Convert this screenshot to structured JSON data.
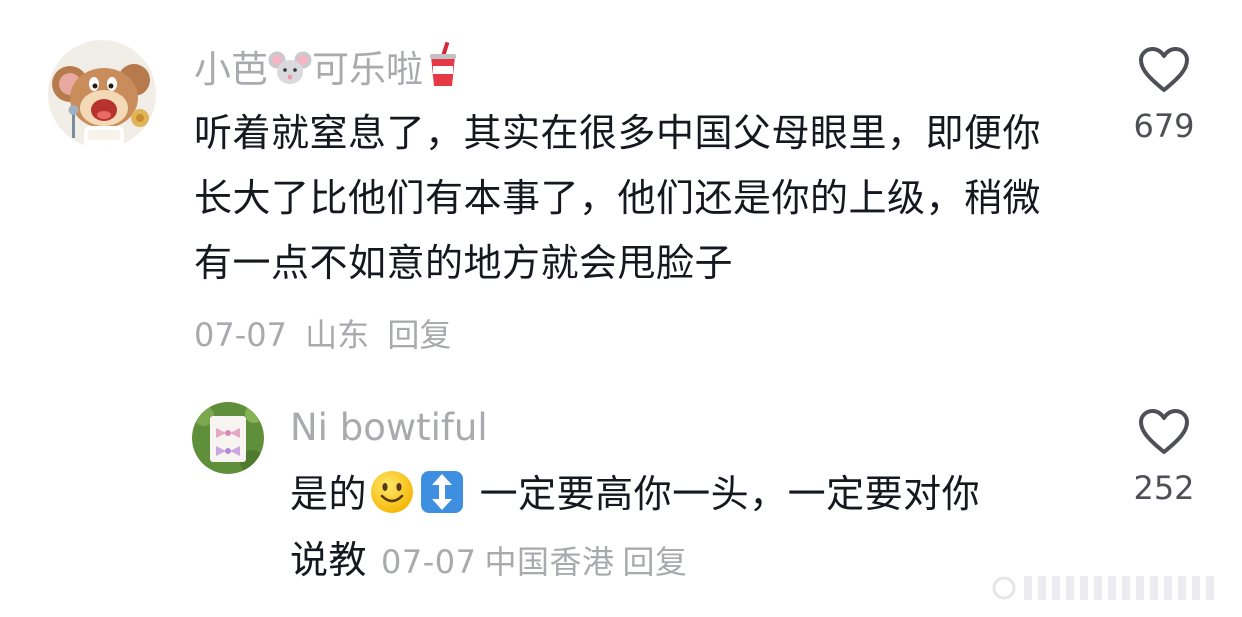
{
  "comments": [
    {
      "username": "小芭🐭可乐啦🥤",
      "username_text": "小芭",
      "username_text_2": "可乐啦",
      "text": "听着就窒息了，其实在很多中国父母眼里，即便你长大了比他们有本事了，他们还是你的上级，稍微有一点不如意的地方就会甩脸子",
      "date": "07-07",
      "location": "山东",
      "reply_label": "回复",
      "likes": "679",
      "avatar_icon": "cartoon-mouse-avatar"
    },
    {
      "username": "Ni bowtiful",
      "text_part1": "是的",
      "text_part2": "一定要高你一头，一定要对你",
      "text_part3": "说教",
      "date": "07-07",
      "location": "中国香港",
      "reply_label": "回复",
      "likes": "252",
      "avatar_icon": "hair-bow-photo-avatar"
    }
  ],
  "icons": {
    "like": "heart-outline-icon",
    "emoji_smile": "slightly-smiling-face-emoji",
    "emoji_updown": "up-down-arrow-emoji"
  },
  "colors": {
    "username": "#a9aaae",
    "text": "#16181f",
    "meta": "#a9aaae",
    "like_count": "#4f5056"
  }
}
